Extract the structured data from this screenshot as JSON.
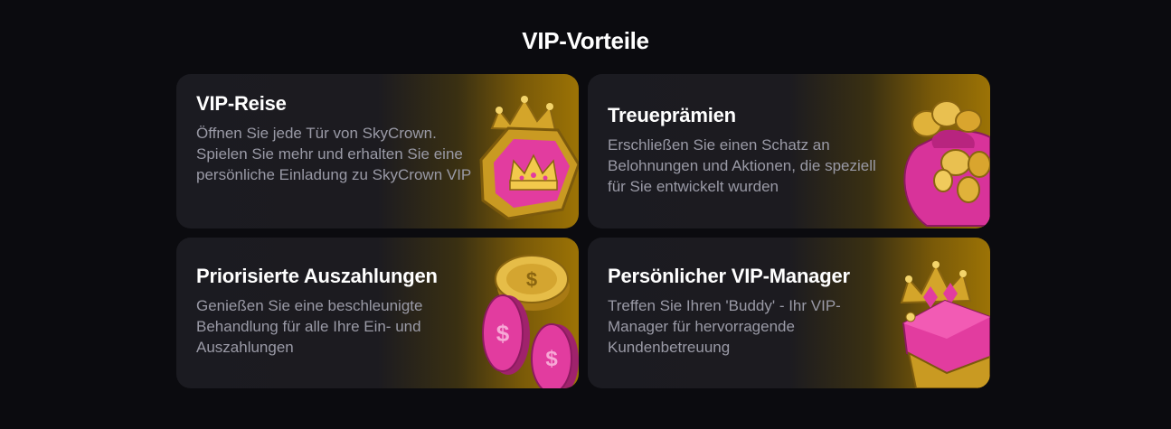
{
  "section": {
    "title": "VIP-Vorteile"
  },
  "cards": [
    {
      "title": "VIP-Reise",
      "description": "Öffnen Sie jede Tür von SkyCrown. Spielen Sie mehr und erhalten Sie eine persönliche Einladung zu SkyCrown VIP",
      "icon": "crown-badge-icon"
    },
    {
      "title": "Treueprämien",
      "description": "Erschließen Sie einen Schatz an Belohnungen und Aktionen, die speziell für Sie entwickelt wurden",
      "icon": "coin-bag-icon"
    },
    {
      "title": "Priorisierte Auszahlungen",
      "description": "Genießen Sie eine beschleunigte Behandlung für alle Ihre Ein- und Auszahlungen",
      "icon": "coins-icon"
    },
    {
      "title": "Persönlicher VIP-Manager",
      "description": "Treffen Sie Ihren 'Buddy' - Ihr VIP-Manager für hervorragende Kundenbetreuung",
      "icon": "crown-manager-icon"
    }
  ],
  "colors": {
    "background": "#0b0b0f",
    "card": "#1c1b20",
    "gold": "#c9a227",
    "pink": "#e0359b",
    "text_muted": "#9a9aa6"
  }
}
